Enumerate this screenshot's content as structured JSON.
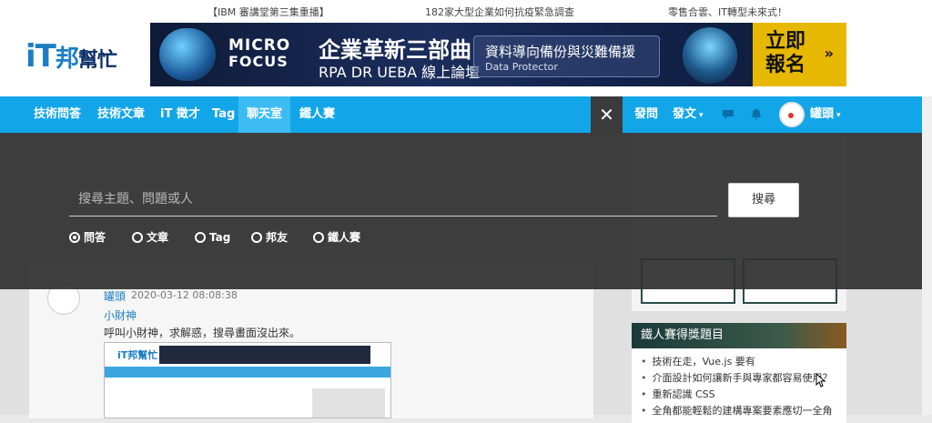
{
  "top_links": [
    "【IBM 審講堂第三集重播】",
    "182家大型企業如何抗疫緊急調查",
    "零售合雲、IT轉型未來式！"
  ],
  "logo": {
    "it": "iT",
    "bang": "邦",
    "help": "幫忙"
  },
  "banner": {
    "brand_line1": "MICRO",
    "brand_line2": "FOCUS",
    "title": "企業革新三部曲",
    "subtitle": "RPA DR UEBA 線上論壇",
    "box_title": "資料導向備份與災難備援",
    "box_sub": "Data Protector",
    "cta": "立即報名",
    "cta_arrow": "»"
  },
  "nav": {
    "items": [
      "技術問答",
      "技術文章",
      "iT 徵才",
      "Tag",
      "聊天室",
      "鐵人賽"
    ],
    "active_index": 4,
    "close": "✕",
    "ask": "發問",
    "post": "發文",
    "caret": "▾",
    "username": "罐頭"
  },
  "search": {
    "placeholder": "搜尋主題、問題或人",
    "button": "搜尋",
    "options": [
      "問答",
      "文章",
      "Tag",
      "邦友",
      "鐵人賽"
    ],
    "selected_index": 0
  },
  "post": {
    "author": "罐頭",
    "time": "2020-03-12 08:08:38",
    "reply_to": "小財神",
    "body": "呼叫小財神，求解惑，搜尋畫面沒出來。",
    "embedded_logo": "iT邦幫忙"
  },
  "award": {
    "heading": "鐵人賽得獎題目",
    "items": [
      "技術在走，Vue.js 要有",
      "介面設計如何讓新手與專家都容易使用？",
      "重新認識 CSS",
      "全角都能輕鬆的建構專案要素應切一全角"
    ]
  }
}
